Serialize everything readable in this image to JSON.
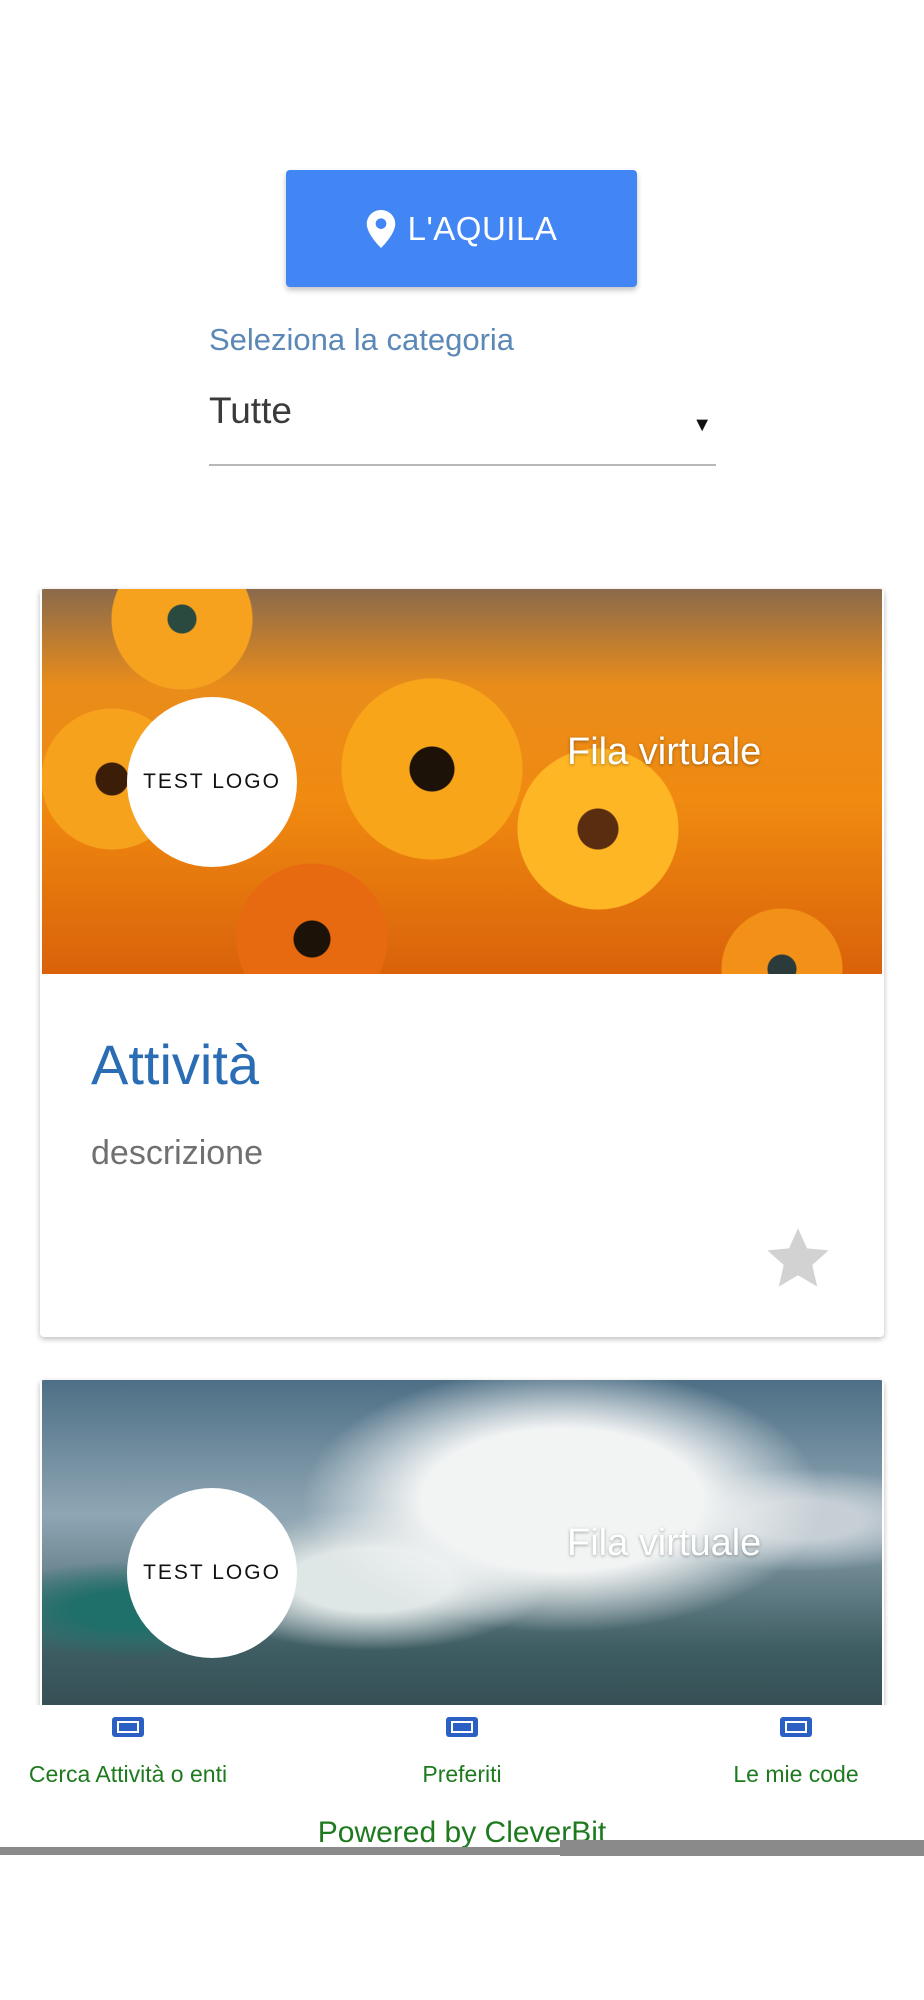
{
  "location": {
    "label": "L'AQUILA",
    "icon": "map-pin-icon"
  },
  "category": {
    "label": "Seleziona la categoria",
    "selected": "Tutte"
  },
  "cards": [
    {
      "logo_text": "TEST LOGO",
      "queue_label": "Fila virtuale",
      "title": "Attività",
      "description": "descrizione",
      "favorite_icon": "star-icon"
    },
    {
      "logo_text": "TEST LOGO",
      "queue_label": "Fila virtuale"
    }
  ],
  "bottom_nav": {
    "items": [
      {
        "label": "Cerca Attività o enti",
        "icon": "ticket-icon"
      },
      {
        "label": "Preferiti",
        "icon": "ticket-icon"
      },
      {
        "label": "Le mie code",
        "icon": "ticket-icon"
      }
    ]
  },
  "footer": {
    "powered_by": "Powered by CleverBit"
  },
  "colors": {
    "primary_button": "#4285f4",
    "title_blue": "#2a6db5",
    "nav_green": "#1e7a1e",
    "nav_icon_blue": "#2b5fc4",
    "star_gray": "#d2d2d2"
  }
}
